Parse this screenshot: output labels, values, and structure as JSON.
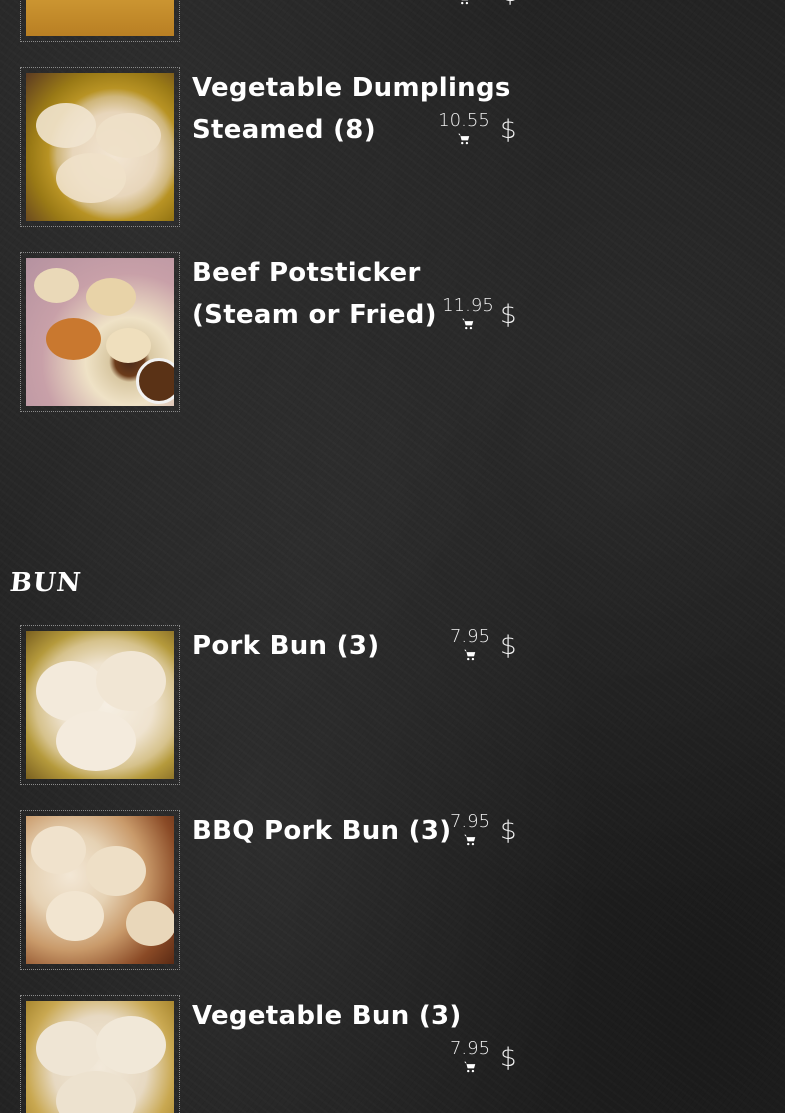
{
  "currency_symbol": "$",
  "sections": {
    "bun_title": "BUN"
  },
  "items": [
    {
      "name": "",
      "price": ""
    },
    {
      "name": "Vegetable Dumplings Steamed (8)",
      "price": "10.55"
    },
    {
      "name": "Beef Potsticker (Steam or Fried)",
      "price": "11.95"
    },
    {
      "name": "Pork Bun (3)",
      "price": "7.95"
    },
    {
      "name": "BBQ Pork Bun (3)",
      "price": "7.95"
    },
    {
      "name": "Vegetable Bun (3)",
      "price": "7.95"
    }
  ],
  "icons": {
    "cart": "shopping-cart-icon"
  },
  "colors": {
    "background": "#232323",
    "text": "#ffffff",
    "thumb_border": "#8a8a8a"
  }
}
